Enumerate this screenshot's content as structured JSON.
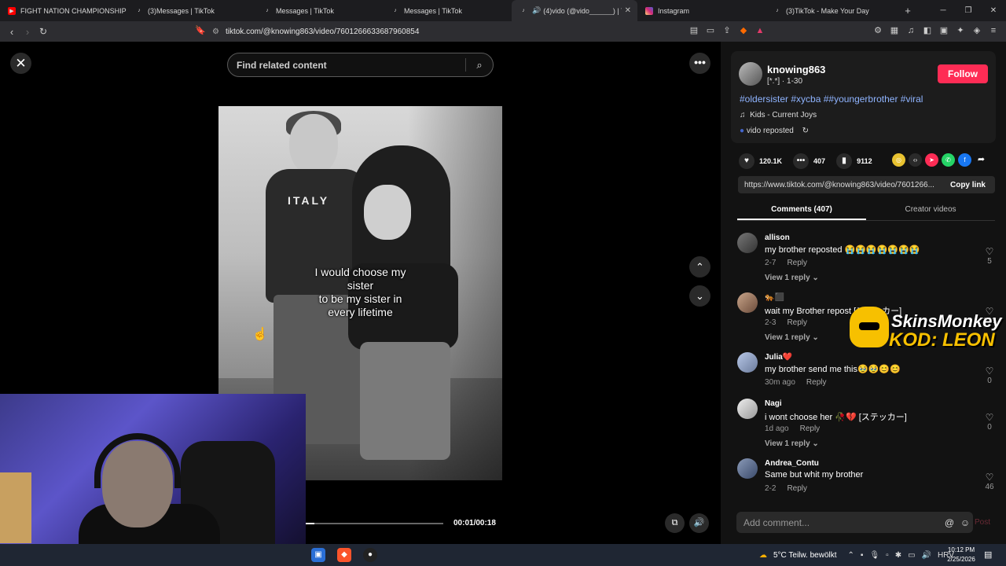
{
  "browser": {
    "tabs": [
      {
        "label": "FIGHT NATION CHAMPIONSHIP - FN",
        "icon": "youtube-icon",
        "color": "#ff0000"
      },
      {
        "label": "(3)Messages | TikTok",
        "icon": "tiktok-icon",
        "color": "#000000"
      },
      {
        "label": "Messages | TikTok",
        "icon": "tiktok-icon",
        "color": "#000000"
      },
      {
        "label": "Messages | TikTok",
        "icon": "tiktok-icon",
        "color": "#000000"
      },
      {
        "label": "(4)vido (@vido______) | TikTok",
        "icon": "tiktok-icon",
        "color": "#000000",
        "active": true
      },
      {
        "label": "Instagram",
        "icon": "instagram-icon",
        "color": "#d62976"
      },
      {
        "label": "(3)TikTok - Make Your Day",
        "icon": "tiktok-icon",
        "color": "#000000"
      }
    ],
    "url": "tiktok.com/@knowing863/video/7601266633687960854"
  },
  "video": {
    "search_placeholder": "Find related content",
    "caption_lines": [
      "I would choose my",
      "sister",
      "to be my sister in",
      "every lifetime"
    ],
    "shirt_text": "ITALY",
    "time": "00:01/00:18",
    "progress": 0.06
  },
  "post": {
    "username": "knowing863",
    "sub": "[*.*] · 1-30",
    "follow_label": "Follow",
    "hashtags": "#oldersister #xycba ##youngerbrother #viral",
    "music": "Kids - Current Joys",
    "repost": "vido reposted",
    "likes": "120.1K",
    "comments_count": "407",
    "saves": "9112",
    "link": "https://www.tiktok.com/@knowing863/video/7601266...",
    "copy_label": "Copy link",
    "tab_comments": "Comments (407)",
    "tab_creator": "Creator videos",
    "add_comment_placeholder": "Add comment...",
    "post_label": "Post"
  },
  "comments": [
    {
      "name": "allison",
      "text": "my brother reposted 😭😭😭😭😭😭😭",
      "time": "2-7",
      "reply": "Reply",
      "likes": "5",
      "view_replies": "View 1 reply"
    },
    {
      "name": "🐅⬛",
      "text": "wait my Brother repost [ステッカー]",
      "time": "2-3",
      "reply": "Reply",
      "likes": "131",
      "view_replies": "View 1 reply"
    },
    {
      "name": "Julia❤️",
      "text": "my brother send me this🥹🥹😊😊",
      "time": "30m ago",
      "reply": "Reply",
      "likes": "0",
      "view_replies": ""
    },
    {
      "name": "Nagi",
      "text": "i wont choose her 🥀💔 [ステッカー]",
      "time": "1d ago",
      "reply": "Reply",
      "likes": "0",
      "view_replies": "View 1 reply"
    },
    {
      "name": "Andrea_Contu",
      "text": "Same but whit my brother",
      "time": "2-2",
      "reply": "Reply",
      "likes": "46",
      "view_replies": ""
    }
  ],
  "promo": {
    "line1": "SkinsMonkey",
    "line2": "KOD: LEON"
  },
  "taskbar": {
    "weather": "5°C  Teilw. bewölkt",
    "lang": "HRV",
    "time": "10:12 PM",
    "date": "2/25/2026"
  }
}
